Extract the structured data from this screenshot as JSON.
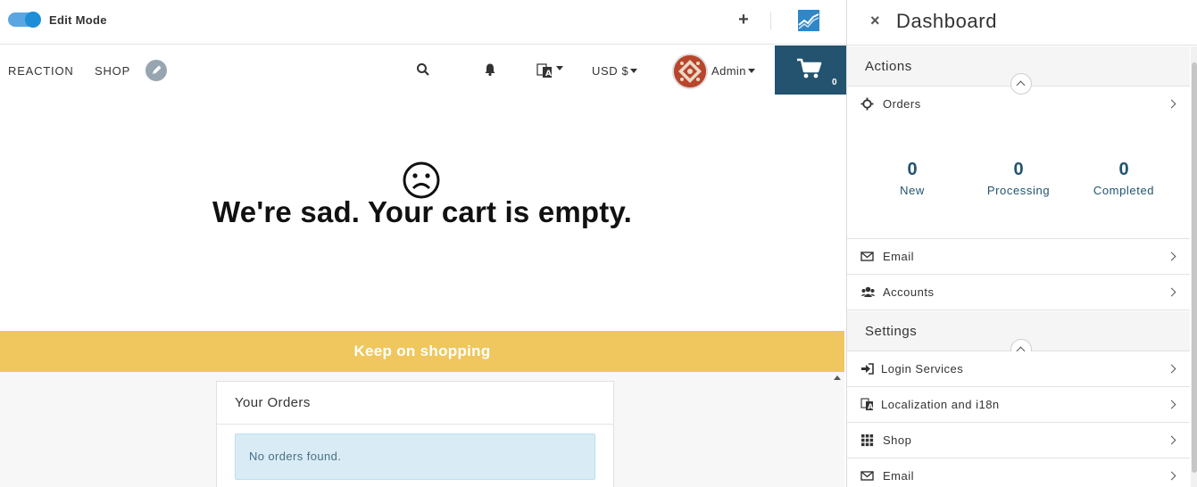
{
  "topbar": {
    "edit_mode_label": "Edit Mode",
    "add_label": "+"
  },
  "nav": {
    "links": [
      "REACTION",
      "SHOP"
    ],
    "currency": "USD $",
    "user_name": "Admin",
    "cart_count": "0"
  },
  "cart": {
    "empty_title": "We're sad. Your cart is empty.",
    "keep_shopping_label": "Keep on shopping"
  },
  "orders_card": {
    "title": "Your Orders",
    "empty_message": "No orders found."
  },
  "dashboard": {
    "title": "Dashboard",
    "close_label": "×",
    "actions_label": "Actions",
    "settings_label": "Settings",
    "orders_row_label": "Orders",
    "order_stats": [
      {
        "value": "0",
        "label": "New"
      },
      {
        "value": "0",
        "label": "Processing"
      },
      {
        "value": "0",
        "label": "Completed"
      }
    ],
    "action_rows": [
      {
        "label": "Email",
        "icon": "envelope-icon"
      },
      {
        "label": "Accounts",
        "icon": "users-icon"
      }
    ],
    "settings_rows": [
      {
        "label": "Login Services",
        "icon": "sign-in-icon"
      },
      {
        "label": "Localization and i18n",
        "icon": "translate-icon"
      },
      {
        "label": "Shop",
        "icon": "grid-icon"
      },
      {
        "label": "Email",
        "icon": "envelope-icon"
      }
    ]
  },
  "colors": {
    "accent_blue": "#23536e",
    "toggle_blue": "#1e8fd6",
    "keep_shopping_yellow": "#efc75e",
    "info_bg": "#d9ecf5"
  }
}
